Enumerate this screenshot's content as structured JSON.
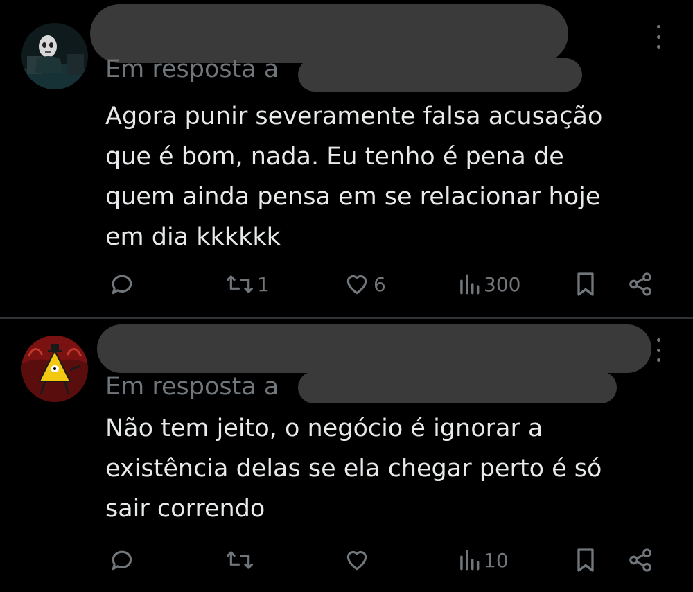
{
  "tweets": [
    {
      "reply_label": "Em resposta a",
      "body_lines": [
        "Agora punir severamente falsa acusação",
        "que é bom, nada. Eu tenho é pena de",
        "quem ainda pensa em se relacionar hoje",
        "em dia kkkkkk"
      ],
      "actions": {
        "replies": "",
        "retweets": "1",
        "likes": "6",
        "views": "300"
      },
      "avatar_icon": "skull-mask-avatar"
    },
    {
      "reply_label": "Em resposta a",
      "body_lines": [
        "Não tem jeito, o negócio é ignorar a",
        "existência delas se ela chegar perto é só",
        "sair correndo"
      ],
      "actions": {
        "replies": "",
        "retweets": "",
        "likes": "",
        "views": "10"
      },
      "avatar_icon": "triangle-character-avatar"
    }
  ],
  "icons": [
    "reply-icon",
    "retweet-icon",
    "like-icon",
    "views-icon",
    "bookmark-icon",
    "share-icon",
    "more-icon"
  ],
  "colors": {
    "background": "#000000",
    "text": "#e7e9ea",
    "muted": "#71767b",
    "divider": "#2f3336",
    "redaction": "#3a3a3a"
  }
}
